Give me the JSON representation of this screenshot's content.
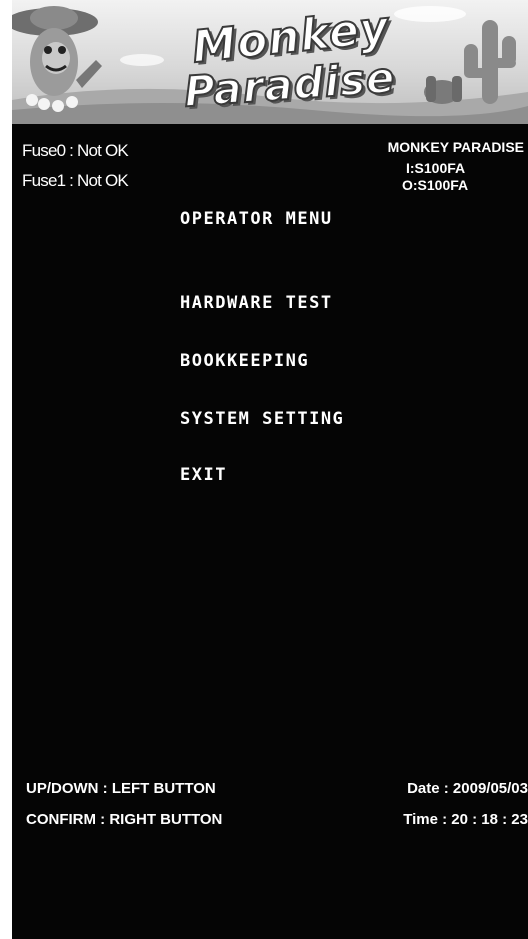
{
  "banner": {
    "logo_line1": "Monkey",
    "logo_line2": "Paradise"
  },
  "status": {
    "fuse0": "Fuse0 : Not OK",
    "fuse1": "Fuse1 : Not OK"
  },
  "game": {
    "title": "MONKEY PARADISE",
    "input_version": "I:S100FA",
    "output_version": "O:S100FA"
  },
  "menu": {
    "title": "OPERATOR MENU",
    "items": [
      {
        "label": "HARDWARE TEST"
      },
      {
        "label": "BOOKKEEPING"
      },
      {
        "label": "SYSTEM SETTING"
      },
      {
        "label": "EXIT"
      }
    ]
  },
  "footer": {
    "up_down_help": "UP/DOWN : LEFT BUTTON",
    "confirm_help": "CONFIRM : RIGHT BUTTON",
    "date": "Date : 2009/05/03",
    "time": "Time : 20 : 18 : 23"
  },
  "colors": {
    "background": "#050505",
    "text": "#ffffff",
    "banner": "#d8d8d8"
  }
}
